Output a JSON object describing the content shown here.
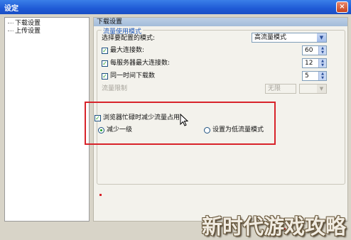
{
  "window": {
    "title": "设定",
    "close_label": "×"
  },
  "tree": {
    "items": [
      "下载设置",
      "上传设置"
    ]
  },
  "panel": {
    "header": "下载设置",
    "group_title": "流量使用模式",
    "mode_label": "选择要配置的模式:",
    "mode_value": "高流量模式",
    "max_conn_label": "最大连接数:",
    "max_conn_value": "60",
    "per_server_label": "每服务器最大连接数:",
    "per_server_value": "12",
    "simul_label": "同一时间下载数",
    "simul_value": "5",
    "rate_limit_label": "流量限制",
    "rate_limit_value": "无限"
  },
  "highlight": {
    "browser_busy_label": "浏览器忙碌时减少流量占用",
    "reduce_label": "减少一级",
    "low_mode_label": "设置为低流量模式"
  },
  "watermark": "新时代游戏攻略",
  "colors": {
    "accent": "#1f5ad6",
    "highlight_border": "#d8232a",
    "check": "#21a121"
  }
}
